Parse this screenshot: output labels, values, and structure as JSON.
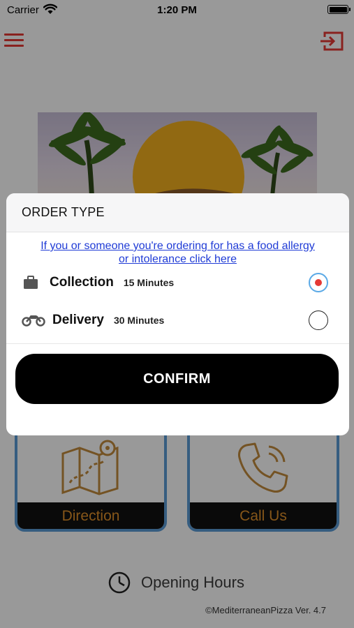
{
  "status_bar": {
    "carrier": "Carrier",
    "time": "1:20 PM"
  },
  "nav": {
    "menu_icon": "hamburger-menu-icon",
    "login_icon": "sign-in-icon",
    "accent_color": "#e53935"
  },
  "background": {
    "tiles": [
      {
        "label": "Direction",
        "icon": "map-icon"
      },
      {
        "label": "Call Us",
        "icon": "phone-icon"
      }
    ],
    "opening_hours_label": "Opening Hours",
    "version_text": "©MediterraneanPizza Ver. 4.7",
    "tile_label_color": "#e0902a",
    "tile_border_color": "#5b9bd5"
  },
  "modal": {
    "title": "ORDER TYPE",
    "allergy_link_line1": "If you or someone you're ordering for has a food allergy",
    "allergy_link_line2": "or intolerance click here",
    "options": [
      {
        "label": "Collection",
        "time": "15 Minutes",
        "icon": "briefcase-icon",
        "selected": true
      },
      {
        "label": "Delivery",
        "time": "30 Minutes",
        "icon": "motorbike-icon",
        "selected": false
      }
    ],
    "confirm_label": "CONFIRM",
    "link_color": "#1f3bd6",
    "selected_ring_color": "#5aa9e6",
    "selected_dot_color": "#e53935"
  }
}
